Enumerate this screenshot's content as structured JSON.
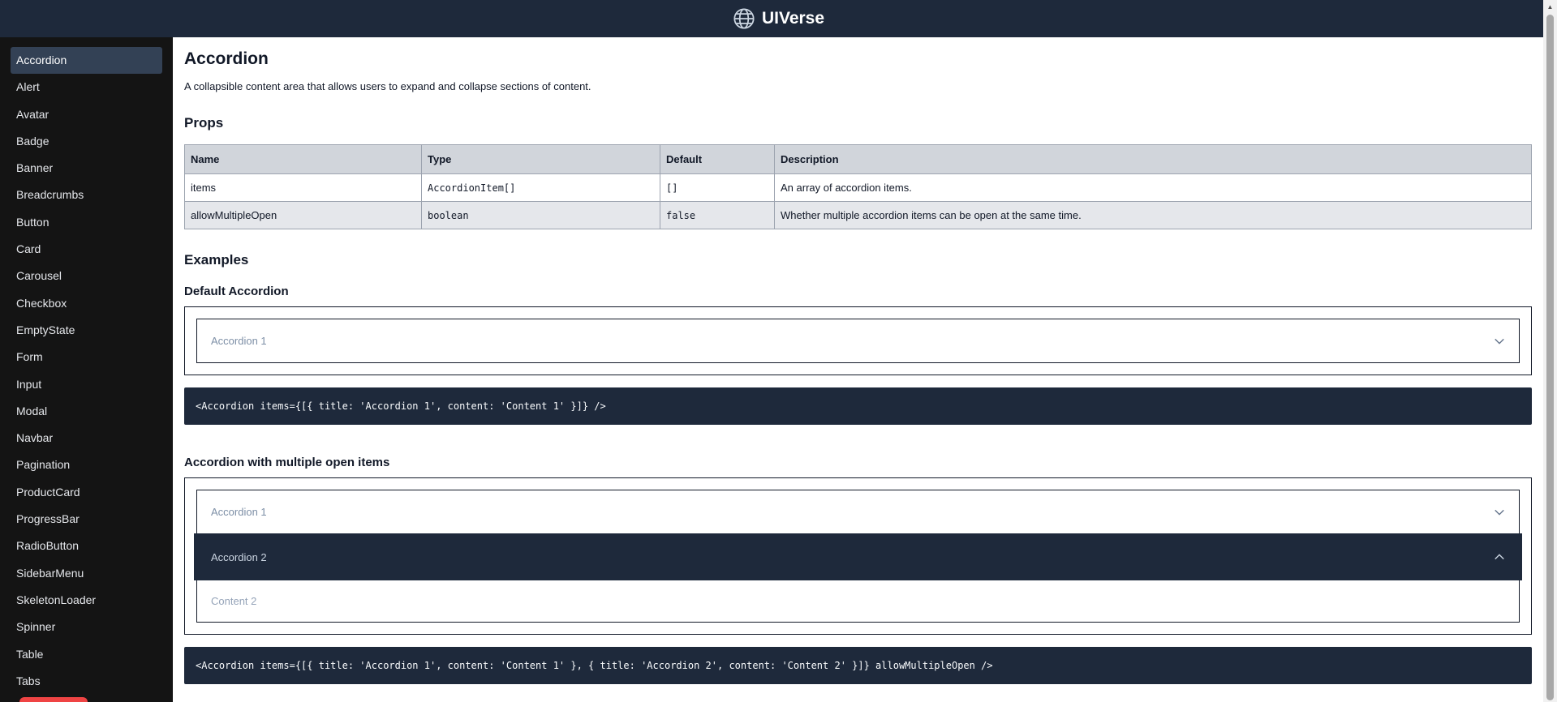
{
  "header": {
    "brand": "UIVerse",
    "logo_icon": "globe-icon"
  },
  "sidebar": {
    "active": "Accordion",
    "items": [
      {
        "label": "Accordion"
      },
      {
        "label": "Alert"
      },
      {
        "label": "Avatar"
      },
      {
        "label": "Badge"
      },
      {
        "label": "Banner"
      },
      {
        "label": "Breadcrumbs"
      },
      {
        "label": "Button"
      },
      {
        "label": "Card"
      },
      {
        "label": "Carousel"
      },
      {
        "label": "Checkbox"
      },
      {
        "label": "EmptyState"
      },
      {
        "label": "Form"
      },
      {
        "label": "Input"
      },
      {
        "label": "Modal"
      },
      {
        "label": "Navbar"
      },
      {
        "label": "Pagination"
      },
      {
        "label": "ProductCard"
      },
      {
        "label": "ProgressBar"
      },
      {
        "label": "RadioButton"
      },
      {
        "label": "SidebarMenu"
      },
      {
        "label": "SkeletonLoader"
      },
      {
        "label": "Spinner"
      },
      {
        "label": "Table"
      },
      {
        "label": "Tabs"
      }
    ]
  },
  "page": {
    "title": "Accordion",
    "description": "A collapsible content area that allows users to expand and collapse sections of content.",
    "props_heading": "Props",
    "examples_heading": "Examples"
  },
  "props_table": {
    "headers": [
      "Name",
      "Type",
      "Default",
      "Description"
    ],
    "rows": [
      [
        "items",
        "AccordionItem[]",
        "[]",
        "An array of accordion items."
      ],
      [
        "allowMultipleOpen",
        "boolean",
        "false",
        "Whether multiple accordion items can be open at the same time."
      ]
    ]
  },
  "examples": {
    "default": {
      "title": "Default Accordion",
      "items": [
        {
          "title": "Accordion 1"
        }
      ],
      "code": "<Accordion items={[{ title: 'Accordion 1', content: 'Content 1' }]} />"
    },
    "multiple": {
      "title": "Accordion with multiple open items",
      "items": [
        {
          "title": "Accordion 1",
          "open": false
        },
        {
          "title": "Accordion 2",
          "open": true,
          "content": "Content 2"
        }
      ],
      "code": "<Accordion items={[{ title: 'Accordion 1', content: 'Content 1' }, { title: 'Accordion 2', content: 'Content 2' }]} allowMultipleOpen />"
    }
  },
  "colors": {
    "header_bg": "#1e293b",
    "sidebar_bg": "#141414",
    "sidebar_active": "#334155",
    "code_bg": "#1e293b",
    "table_header_bg": "#d1d5db",
    "table_even_row_bg": "#e5e7eb"
  }
}
